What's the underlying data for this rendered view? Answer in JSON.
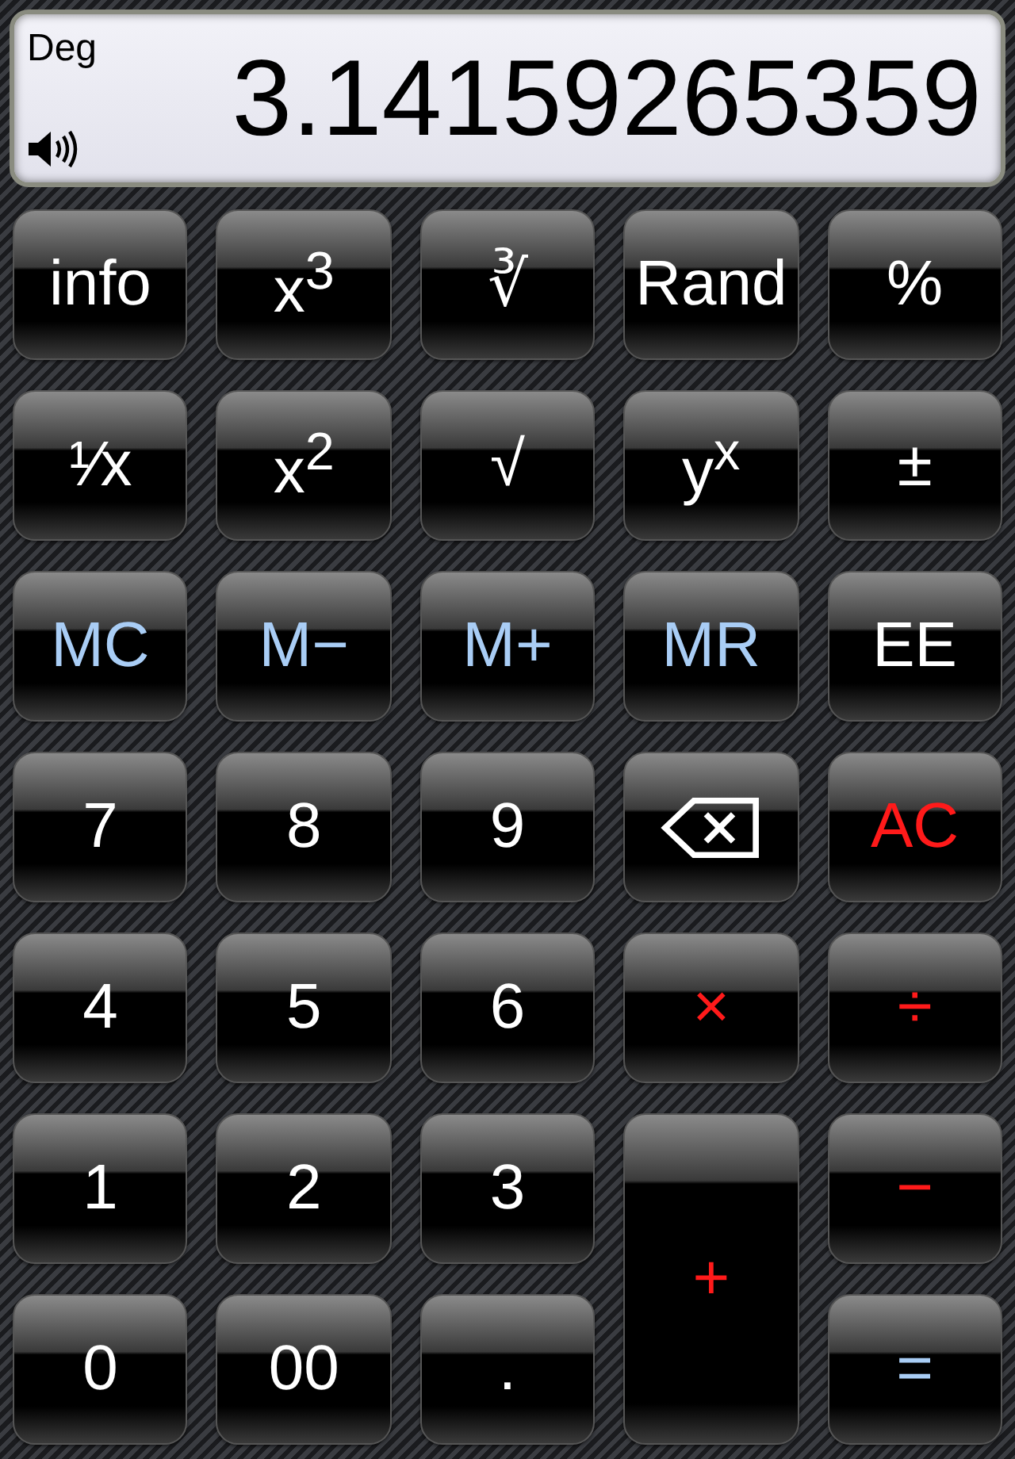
{
  "display": {
    "mode": "Deg",
    "value": "3.14159265359"
  },
  "keys": [
    {
      "label": "info",
      "color": "#ffffff",
      "kind": "text"
    },
    {
      "label": "x$^{3}$",
      "color": "#ffffff",
      "kind": "text"
    },
    {
      "label": "∛",
      "color": "#ffffff",
      "kind": "text"
    },
    {
      "label": "Rand",
      "color": "#ffffff",
      "kind": "text"
    },
    {
      "label": "%",
      "color": "#ffffff",
      "kind": "text"
    },
    {
      "label": "¹⁄x",
      "color": "#ffffff",
      "kind": "text"
    },
    {
      "label": "x$^{2}$",
      "color": "#ffffff",
      "kind": "text"
    },
    {
      "label": "√",
      "color": "#ffffff",
      "kind": "text"
    },
    {
      "label": "y$^{x}$",
      "color": "#ffffff",
      "kind": "text"
    },
    {
      "label": "±",
      "color": "#ffffff",
      "kind": "text"
    },
    {
      "label": "MC",
      "color": "#a9cdf5",
      "kind": "text"
    },
    {
      "label": "M−",
      "color": "#a9cdf5",
      "kind": "text"
    },
    {
      "label": "M+",
      "color": "#a9cdf5",
      "kind": "text"
    },
    {
      "label": "MR",
      "color": "#a9cdf5",
      "kind": "text"
    },
    {
      "label": "EE",
      "color": "#ffffff",
      "kind": "text"
    },
    {
      "label": "7",
      "color": "#ffffff",
      "kind": "text"
    },
    {
      "label": "8",
      "color": "#ffffff",
      "kind": "text"
    },
    {
      "label": "9",
      "color": "#ffffff",
      "kind": "text"
    },
    {
      "color": "#ffffff",
      "kind": "backspace"
    },
    {
      "label": "AC",
      "color": "#ff1a1a",
      "kind": "text"
    },
    {
      "label": "4",
      "color": "#ffffff",
      "kind": "text"
    },
    {
      "label": "5",
      "color": "#ffffff",
      "kind": "text"
    },
    {
      "label": "6",
      "color": "#ffffff",
      "kind": "text"
    },
    {
      "label": "×",
      "color": "#ff1a1a",
      "kind": "text"
    },
    {
      "label": "÷",
      "color": "#ff1a1a",
      "kind": "text"
    },
    {
      "label": "1",
      "color": "#ffffff",
      "kind": "text"
    },
    {
      "label": "2",
      "color": "#ffffff",
      "kind": "text"
    },
    {
      "label": "3",
      "color": "#ffffff",
      "kind": "text"
    },
    {
      "label": "−",
      "color": "#ff1a1a",
      "kind": "text"
    },
    {
      "label": "+",
      "color": "#ff1a1a",
      "kind": "tall"
    },
    {
      "label": "0",
      "color": "#ffffff",
      "kind": "text"
    },
    {
      "label": "00",
      "color": "#ffffff",
      "kind": "text"
    },
    {
      "label": ".",
      "color": "#ffffff",
      "kind": "text"
    },
    {
      "label": "=",
      "color": "#a9cdf5",
      "kind": "text"
    }
  ]
}
